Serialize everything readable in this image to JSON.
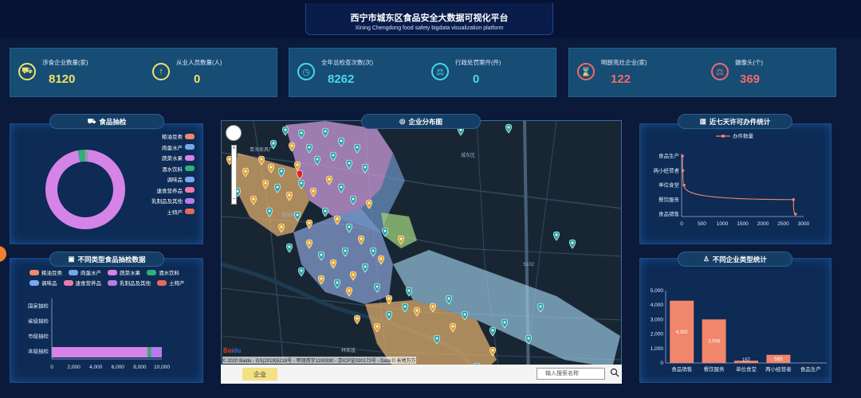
{
  "header": {
    "title": "西宁市城东区食品安全大数据可视化平台",
    "subtitle": "Xining Chengdong food safety bigdata visualization platform"
  },
  "stats": [
    {
      "label": "涉食企业数量(家)",
      "value": "8120",
      "color": "#f0e36a",
      "icon": "car-icon"
    },
    {
      "label": "从业人员数量(人)",
      "value": "0",
      "color": "#f0e36a",
      "icon": "upload-icon"
    },
    {
      "label": "全年总检查次数(次)",
      "value": "8262",
      "color": "#4ad9e8",
      "icon": "clock-icon"
    },
    {
      "label": "行政处罚案件(件)",
      "value": "0",
      "color": "#4ad9e8",
      "icon": "scale-icon"
    },
    {
      "label": "明厨亮灶企业(家)",
      "value": "122",
      "color": "#ef6b6b",
      "icon": "hourglass-icon"
    },
    {
      "label": "摄像头(个)",
      "value": "369",
      "color": "#ef6b6b",
      "icon": "scale-icon"
    }
  ],
  "panels": {
    "food_sampling": "食品抽检",
    "type_sampling": "不同类型食品抽检数据",
    "enterprise_dist": "企业分布图",
    "permits": "近七天许可办件统计",
    "enterprise_types": "不同企业类型统计"
  },
  "food_legend": [
    "粮油豆类",
    "肉蛋水产",
    "蔬菜水果",
    "酒水饮料",
    "调味品",
    "速食营养品",
    "乳制品及其他",
    "土特产"
  ],
  "legend_colors": [
    "#f0866a",
    "#73a9e8",
    "#d683e8",
    "#2fb07a",
    "#7aa7f0",
    "#f07aa6",
    "#b97aea",
    "#e8695a"
  ],
  "map": {
    "copyright": "© 2020 Baidu - GS(2019)5218号 - 甲测资字1100930 - 京ICP证030173号 - Data © 长地万方",
    "tab": "企业",
    "search_placeholder": "输入搜索名称",
    "road_labels": [
      "青海家具厂",
      "青海药材",
      "城东区",
      "S102",
      "林家崖"
    ]
  },
  "chart_data": [
    {
      "type": "pie",
      "title": "食品抽检",
      "categories": [
        "粮油豆类",
        "肉蛋水产",
        "蔬菜水果",
        "酒水饮料",
        "调味品",
        "速食营养品",
        "乳制品及其他",
        "土特产"
      ],
      "values": [
        0.5,
        0.5,
        96,
        3,
        0,
        0,
        0,
        0
      ]
    },
    {
      "type": "bar",
      "title": "不同类型食品抽检数据",
      "orientation": "horizontal",
      "stacked": true,
      "categories": [
        "国家抽检",
        "省级抽检",
        "市级抽检",
        "本级抽检"
      ],
      "series": [
        {
          "name": "蔬菜水果",
          "values": [
            0,
            0,
            0,
            8700
          ]
        },
        {
          "name": "酒水饮料",
          "values": [
            0,
            0,
            0,
            300
          ]
        },
        {
          "name": "乳制品及其他",
          "values": [
            0,
            0,
            0,
            1000
          ]
        }
      ],
      "xticks": [
        "0",
        "2,000",
        "4,000",
        "6,000",
        "8,000",
        "10,000"
      ],
      "xlim": [
        0,
        10000
      ]
    },
    {
      "type": "line",
      "title": "近七天许可办件统计",
      "legend": "办件数量",
      "categories": [
        "食品生产",
        "两小经营者",
        "单位食堂",
        "餐饮服务",
        "食品销售"
      ],
      "values": [
        20,
        30,
        60,
        2750,
        2800
      ],
      "xticks": [
        "0",
        "500",
        "1000",
        "1500",
        "2000",
        "2500",
        "3000"
      ],
      "xlim": [
        0,
        3000
      ]
    },
    {
      "type": "bar",
      "title": "不同企业类型统计",
      "categories": [
        "食品销售",
        "餐饮服务",
        "单位食堂",
        "两小经营者",
        "食品生产"
      ],
      "values": [
        4300,
        3008,
        157,
        565,
        15
      ],
      "labels": [
        "4,300",
        "3,008",
        "157",
        "565",
        ""
      ],
      "yticks": [
        "0",
        "1,000",
        "2,000",
        "3,000",
        "4,000",
        "5,000"
      ],
      "ylim": [
        0,
        5000
      ]
    }
  ]
}
